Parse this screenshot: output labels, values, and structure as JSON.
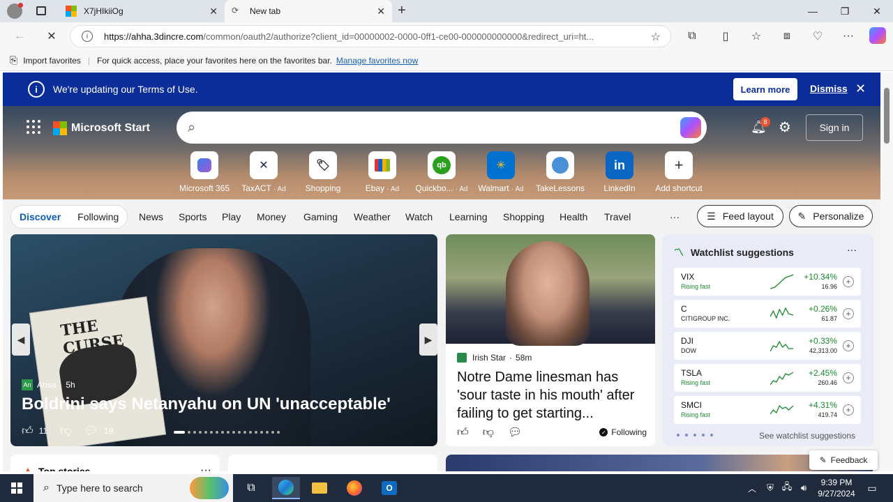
{
  "browser": {
    "tabs": [
      {
        "title": "X7jHIkiiOg"
      },
      {
        "title": "New tab"
      }
    ],
    "url_host": "https://ahha.3dincre.com",
    "url_rest": "/common/oauth2/authorize?client_id=00000002-0000-0ff1-ce00-000000000000&redirect_uri=ht..."
  },
  "favorites_bar": {
    "import_label": "Import favorites",
    "hint": "For quick access, place your favorites here on the favorites bar.",
    "manage_link": "Manage favorites now"
  },
  "banner": {
    "message": "We're updating our Terms of Use.",
    "learn_more": "Learn more",
    "dismiss": "Dismiss"
  },
  "header": {
    "brand": "Microsoft Start",
    "notification_count": "8",
    "sign_in": "Sign in"
  },
  "shortcuts": [
    {
      "label": "Microsoft 365",
      "ad": ""
    },
    {
      "label": "TaxACT",
      "ad": "· Ad"
    },
    {
      "label": "Shopping",
      "ad": ""
    },
    {
      "label": "Ebay",
      "ad": "· Ad"
    },
    {
      "label": "Quickbo...",
      "ad": "· Ad"
    },
    {
      "label": "Walmart",
      "ad": "· Ad"
    },
    {
      "label": "TakeLessons",
      "ad": ""
    },
    {
      "label": "LinkedIn",
      "ad": ""
    },
    {
      "label": "Add shortcut",
      "ad": ""
    }
  ],
  "feed_tabs": {
    "discover": "Discover",
    "following": "Following",
    "categories": [
      "News",
      "Sports",
      "Play",
      "Money",
      "Gaming",
      "Weather",
      "Watch",
      "Learning",
      "Shopping",
      "Health",
      "Travel"
    ],
    "more": "···",
    "feed_layout": "Feed layout",
    "personalize": "Personalize"
  },
  "main_story": {
    "source": "Ansa",
    "age": "5h",
    "sign_text": "THE CURSE",
    "title": "Boldrini says Netanyahu on UN 'unacceptable'",
    "likes": "11",
    "comments": "19"
  },
  "second_story": {
    "source": "Irish Star",
    "age": "58m",
    "title": "Notre Dame linesman has 'sour taste in his mouth' after failing to get starting...",
    "following": "Following"
  },
  "watchlist": {
    "title": "Watchlist suggestions",
    "stocks": [
      {
        "symbol": "VIX",
        "sub": "Rising fast",
        "change": "+10.34%",
        "price": "16.96",
        "rising": true
      },
      {
        "symbol": "C",
        "sub": "CITIGROUP INC.",
        "change": "+0.26%",
        "price": "61.87",
        "rising": false
      },
      {
        "symbol": "DJI",
        "sub": "DOW",
        "change": "+0.33%",
        "price": "42,313.00",
        "rising": false
      },
      {
        "symbol": "TSLA",
        "sub": "Rising fast",
        "change": "+2.45%",
        "price": "260.46",
        "rising": true
      },
      {
        "symbol": "SMCI",
        "sub": "Rising fast",
        "change": "+4.31%",
        "price": "419.74",
        "rising": true
      }
    ],
    "see_all": "See watchlist suggestions"
  },
  "bottom": {
    "top_stories": "Top stories",
    "feedback": "Feedback"
  },
  "taskbar": {
    "search_placeholder": "Type here to search",
    "time": "9:39 PM",
    "date": "9/27/2024"
  },
  "colors": {
    "banner_bg": "#0a2d9a",
    "accent": "#0a5cbb",
    "positive": "#178a2e",
    "taskbar": "#1f2b3d"
  }
}
